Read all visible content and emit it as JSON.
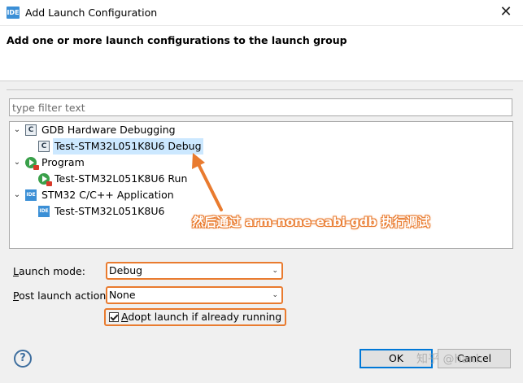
{
  "window": {
    "title": "Add Launch Configuration",
    "app_icon_label": "IDE",
    "close_glyph": "✕"
  },
  "header": {
    "message": "Add one or more launch configurations to the launch group"
  },
  "filter": {
    "placeholder": "type filter text",
    "value": ""
  },
  "tree": {
    "groups": [
      {
        "label": "GDB Hardware Debugging",
        "icon": "c-config-icon",
        "expanded": true,
        "children": [
          {
            "label": "Test-STM32L051K8U6 Debug",
            "icon": "c-config-icon",
            "selected": true
          }
        ]
      },
      {
        "label": "Program",
        "icon": "run-program-icon",
        "expanded": true,
        "children": [
          {
            "label": "Test-STM32L051K8U6 Run",
            "icon": "run-program-icon",
            "selected": false
          }
        ]
      },
      {
        "label": "STM32 C/C++ Application",
        "icon": "ide-icon",
        "expanded": true,
        "children": [
          {
            "label": "Test-STM32L051K8U6",
            "icon": "ide-icon",
            "selected": false
          }
        ]
      }
    ],
    "c_icon_glyph": "C",
    "ide_icon_glyph": "IDE",
    "expand_glyph": "⌄"
  },
  "annotation": {
    "text": "然后通过 arm-none-eabi-gdb 执行调试",
    "color": "#e97b2f"
  },
  "launch_mode": {
    "label_prefix": "",
    "label_mnemonic": "L",
    "label_rest": "aunch mode:",
    "value": "Debug"
  },
  "post_launch": {
    "label_mnemonic": "P",
    "label_rest": "ost launch action:",
    "value": "None"
  },
  "adopt": {
    "label_mnemonic": "A",
    "label_rest": "dopt launch if already running",
    "checked": true
  },
  "combo_arrow": "⌄",
  "buttons": {
    "help_glyph": "?",
    "ok": "OK",
    "cancel": "Cancel"
  },
  "watermark": "知乎 @hank",
  "colors": {
    "accent": "#e97b2f",
    "selection": "#cce8ff",
    "default_button_border": "#0078d7"
  }
}
